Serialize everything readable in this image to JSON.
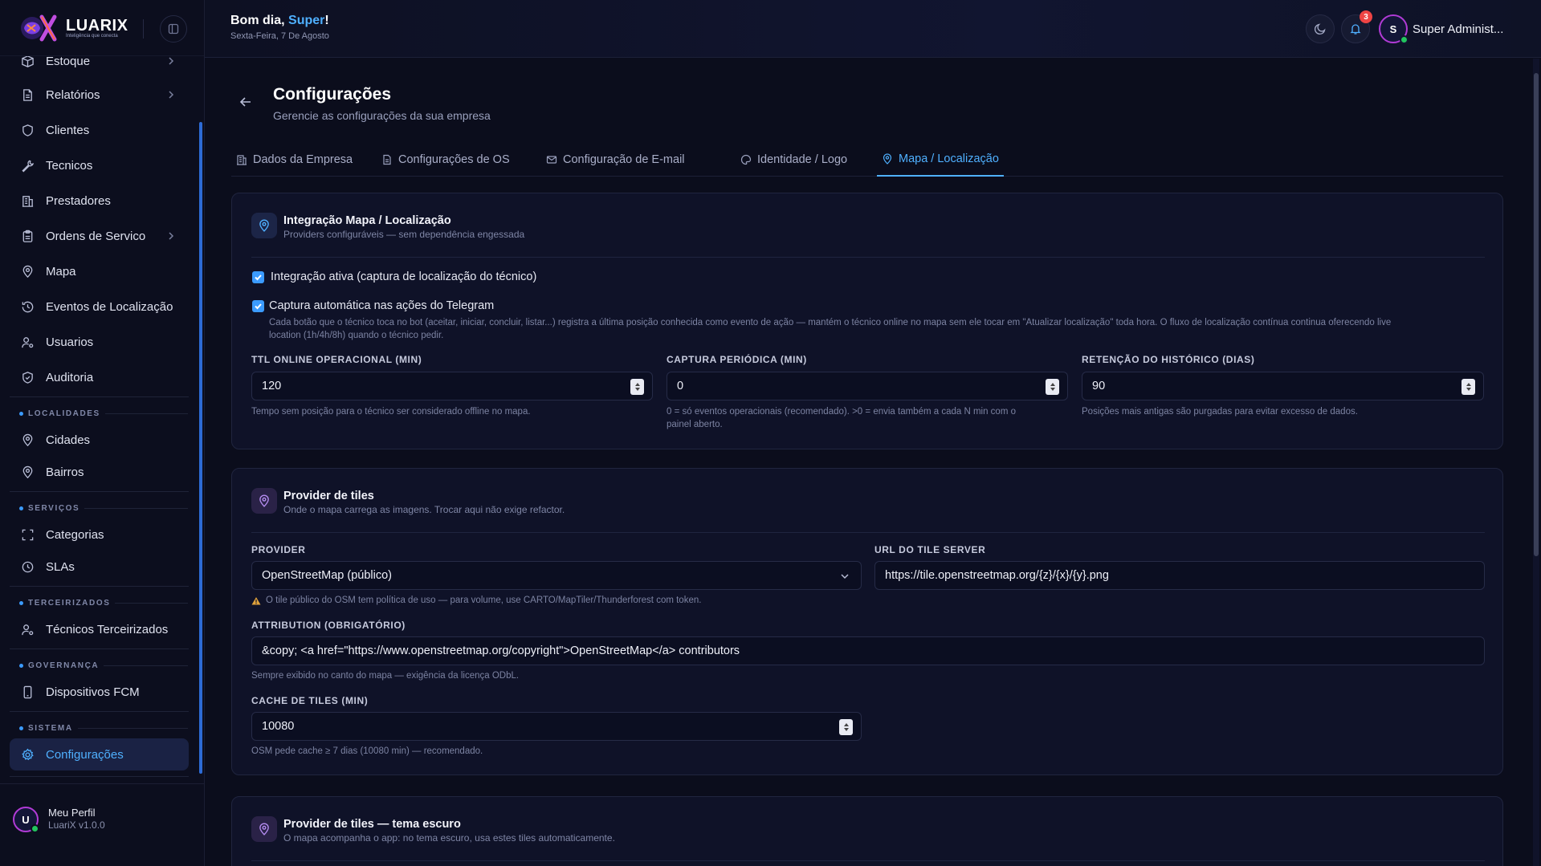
{
  "brand": {
    "name": "LUARIX",
    "tagline": "Inteligência que conecta"
  },
  "header": {
    "greeting_prefix": "Bom dia, ",
    "greeting_name": "Super",
    "greeting_suffix": "!",
    "date": "Sexta-Feira, 7 De Agosto",
    "notifications_count": "3",
    "user_initial": "S",
    "user_name": "Super Administ..."
  },
  "sidebar": {
    "items": [
      {
        "label": "Estoque",
        "icon": "box-icon"
      },
      {
        "label": "Relatórios",
        "icon": "report-icon"
      },
      {
        "label": "Clientes",
        "icon": "shield-icon"
      },
      {
        "label": "Tecnicos",
        "icon": "wrench-icon"
      },
      {
        "label": "Prestadores",
        "icon": "building-icon"
      },
      {
        "label": "Ordens de Servico",
        "icon": "clipboard-icon"
      },
      {
        "label": "Mapa",
        "icon": "map-pin-icon"
      },
      {
        "label": "Eventos de Localização",
        "icon": "history-icon"
      },
      {
        "label": "Usuarios",
        "icon": "user-cog-icon"
      },
      {
        "label": "Auditoria",
        "icon": "shield-check-icon"
      }
    ],
    "sections": {
      "localidades": {
        "title": "LOCALIDADES",
        "items": [
          {
            "label": "Cidades"
          },
          {
            "label": "Bairros"
          }
        ]
      },
      "servicos": {
        "title": "SERVIÇOS",
        "items": [
          {
            "label": "Categorias"
          },
          {
            "label": "SLAs"
          }
        ]
      },
      "terceirizados": {
        "title": "TERCEIRIZADOS",
        "items": [
          {
            "label": "Técnicos Terceirizados"
          }
        ]
      },
      "governanca": {
        "title": "GOVERNANÇA",
        "items": [
          {
            "label": "Dispositivos FCM"
          }
        ]
      },
      "sistema": {
        "title": "SISTEMA",
        "items": [
          {
            "label": "Configurações",
            "active": true
          }
        ]
      }
    },
    "profile": {
      "initial": "U",
      "name": "Meu Perfil",
      "version": "LuariX v1.0.0"
    }
  },
  "page": {
    "title": "Configurações",
    "subtitle": "Gerencie as configurações da sua empresa",
    "tabs": [
      {
        "label": "Dados da Empresa",
        "icon": "building-icon"
      },
      {
        "label": "Configurações de OS",
        "icon": "file-icon"
      },
      {
        "label": "Configuração de E-mail",
        "icon": "mail-icon"
      },
      {
        "label": "Identidade / Logo",
        "icon": "palette-icon"
      },
      {
        "label": "Mapa / Localização",
        "icon": "map-pin-icon",
        "active": true
      }
    ]
  },
  "integration_card": {
    "title": "Integração Mapa / Localização",
    "subtitle": "Providers configuráveis — sem dependência engessada",
    "checkbox_active": {
      "label": "Integração ativa (captura de localização do técnico)",
      "checked": true
    },
    "checkbox_telegram": {
      "label": "Captura automática nas ações do Telegram",
      "checked": true,
      "help_line1": "Cada botão que o técnico toca no bot (aceitar, iniciar, concluir, listar...) registra a última posição conhecida como evento de ação — mantém o técnico online no mapa sem ele tocar em \"Atualizar localização\" toda hora. O fluxo de localização contínua continua oferecendo live",
      "help_line2": "location (1h/4h/8h) quando o técnico pedir."
    },
    "ttl": {
      "label": "TTL ONLINE OPERACIONAL (MIN)",
      "value": "120",
      "help": "Tempo sem posição para o técnico ser considerado offline no mapa."
    },
    "captura": {
      "label": "CAPTURA PERIÓDICA (MIN)",
      "value": "0",
      "help_line1": "0 = só eventos operacionais (recomendado). >0 = envia também a cada N min com o",
      "help_line2": "painel aberto."
    },
    "retencao": {
      "label": "RETENÇÃO DO HISTÓRICO (DIAS)",
      "value": "90",
      "help": "Posições mais antigas são purgadas para evitar excesso de dados."
    }
  },
  "tiles_card": {
    "title": "Provider de tiles",
    "subtitle": "Onde o mapa carrega as imagens. Trocar aqui não exige refactor.",
    "provider": {
      "label": "PROVIDER",
      "value": "OpenStreetMap (público)",
      "warning": "O tile público do OSM tem política de uso — para volume, use CARTO/MapTiler/Thunderforest com token."
    },
    "url": {
      "label": "URL DO TILE SERVER",
      "value": "https://tile.openstreetmap.org/{z}/{x}/{y}.png"
    },
    "attribution": {
      "label": "ATTRIBUTION (OBRIGATÓRIO)",
      "value": "&copy; <a href=\"https://www.openstreetmap.org/copyright\">OpenStreetMap</a> contributors",
      "help": "Sempre exibido no canto do mapa — exigência da licença ODbL."
    },
    "cache": {
      "label": "CACHE DE TILES (MIN)",
      "value": "10080",
      "help": "OSM pede cache ≥ 7 dias (10080 min) — recomendado."
    }
  },
  "dark_tiles_card": {
    "title": "Provider de tiles — tema escuro",
    "subtitle": "O mapa acompanha o app: no tema escuro, usa estes tiles automaticamente."
  },
  "colors": {
    "accent": "#4fb0ff",
    "checkbox": "#3b9bff",
    "badge": "#ef4444",
    "online": "#22c55e",
    "background": "#0b0d1c"
  }
}
